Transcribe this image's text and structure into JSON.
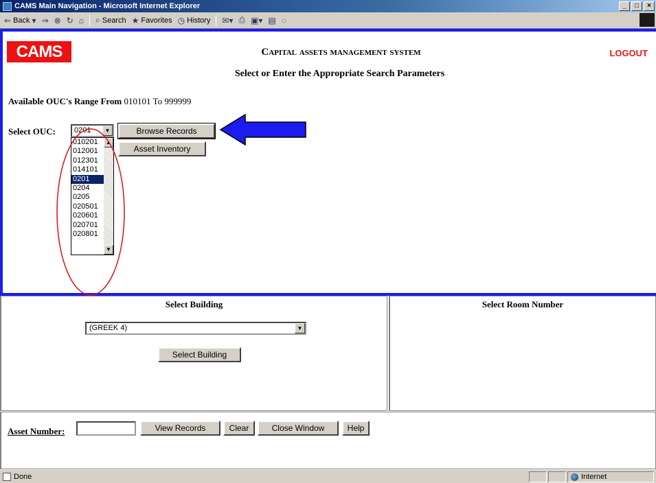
{
  "window": {
    "title": "CAMS Main Navigation - Microsoft Internet Explorer",
    "buttons": [
      "_",
      "□",
      "×"
    ]
  },
  "toolbar": {
    "back": "Back",
    "search": "Search",
    "favorites": "Favorites",
    "history": "History"
  },
  "header": {
    "logo": "CAMS",
    "system_title": "Capital assets management system",
    "logout": "LOGOUT",
    "subtitle": "Select or Enter the Appropriate Search Parameters"
  },
  "ouc": {
    "range_label": "Available OUC's Range From",
    "range_from": "010101",
    "range_to_label": "To",
    "range_to": "999999",
    "select_label": "Select OUC:",
    "selected_value": "0201",
    "options": [
      "010201",
      "012001",
      "012301",
      "014101",
      "0201",
      "0204",
      "0205",
      "020501",
      "020601",
      "020701",
      "020801"
    ],
    "selected_index": 4
  },
  "buttons": {
    "browse_records": "Browse Records",
    "asset_inventory": "Asset Inventory",
    "select_building": "Select Building",
    "view_records": "View Records",
    "clear": "Clear",
    "close_window": "Close Window",
    "help": "Help"
  },
  "building": {
    "heading": "Select Building",
    "selected": "(GREEK 4)"
  },
  "room": {
    "heading": "Select Room Number"
  },
  "asset": {
    "label": "Asset Number:",
    "value": ""
  },
  "status": {
    "text": "Done",
    "zone": "Internet"
  },
  "colors": {
    "frame_border": "#1c1cf0",
    "logo_bg": "#ee1111",
    "logout": "#e21b1b",
    "annotation_arrow": "#1c1cf0",
    "annotation_ellipse": "#dd1111"
  }
}
